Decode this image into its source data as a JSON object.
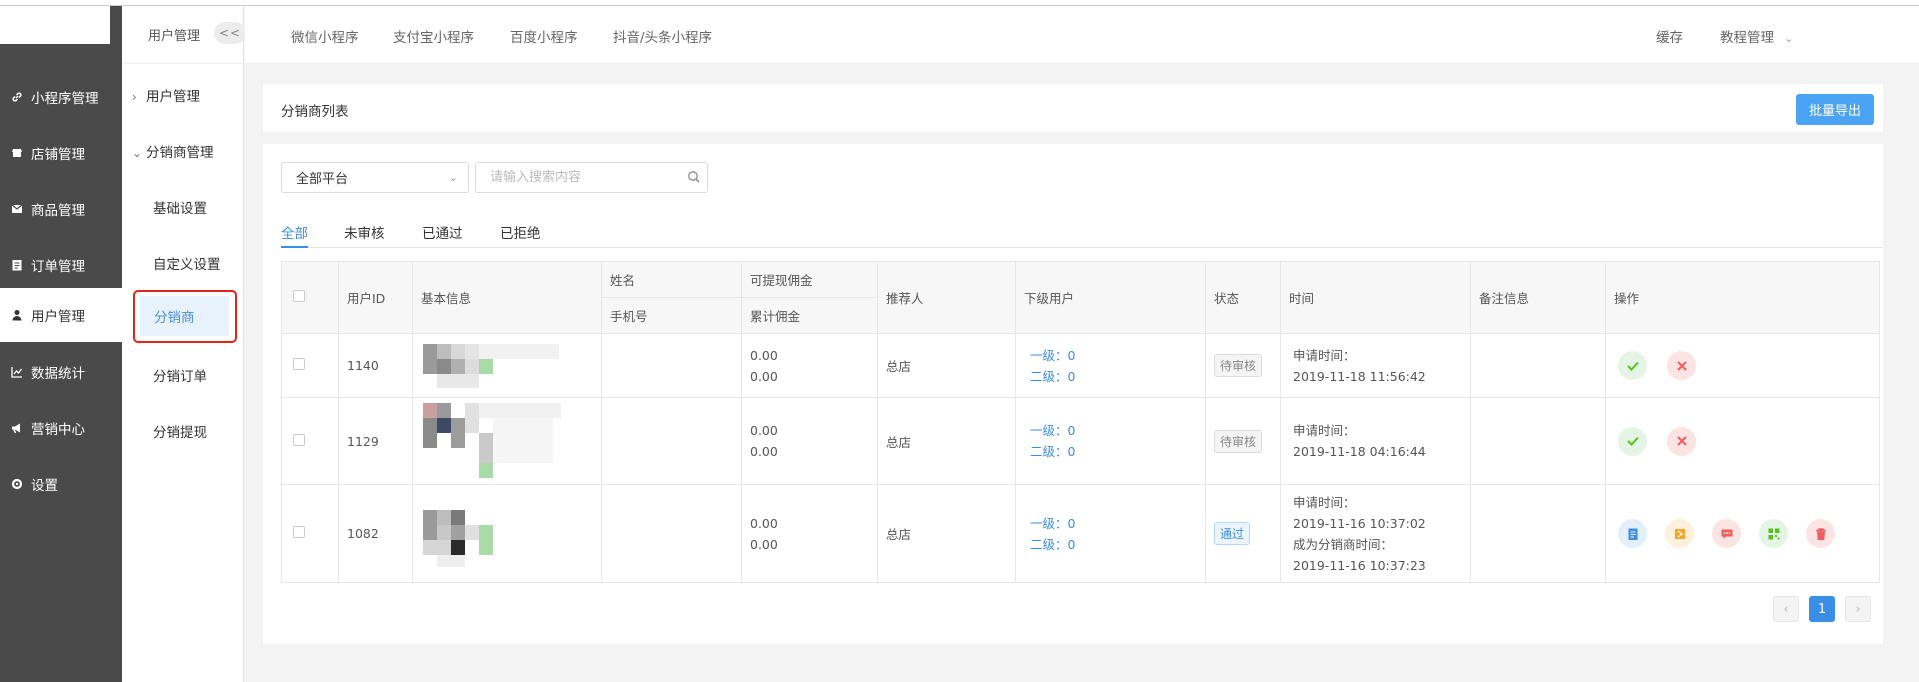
{
  "sidebar": {
    "items": [
      {
        "label": "小程序管理",
        "icon": "link-icon"
      },
      {
        "label": "店铺管理",
        "icon": "store-icon"
      },
      {
        "label": "商品管理",
        "icon": "mail-icon"
      },
      {
        "label": "订单管理",
        "icon": "clipboard-icon"
      },
      {
        "label": "用户管理",
        "icon": "user-icon"
      },
      {
        "label": "数据统计",
        "icon": "chart-icon"
      },
      {
        "label": "营销中心",
        "icon": "megaphone-icon"
      },
      {
        "label": "设置",
        "icon": "gear-icon"
      }
    ]
  },
  "subnav": {
    "title": "用户管理",
    "collapse": "<<",
    "group1": "用户管理",
    "group2": "分销商管理",
    "items": [
      "基础设置",
      "自定义设置",
      "分销商",
      "分销订单",
      "分销提现"
    ]
  },
  "header": {
    "tabs": [
      "微信小程序",
      "支付宝小程序",
      "百度小程序",
      "抖音/头条小程序"
    ],
    "cache": "缓存",
    "account": "教程管理"
  },
  "page": {
    "title": "分销商列表",
    "export_button": "批量导出"
  },
  "filters": {
    "platform": "全部平台",
    "search_placeholder": "请输入搜索内容"
  },
  "tabs": [
    "全部",
    "未审核",
    "已通过",
    "已拒绝"
  ],
  "table": {
    "headers": {
      "user_id": "用户ID",
      "basic": "基本信息",
      "name": "姓名",
      "phone": "手机号",
      "withdrawable": "可提现佣金",
      "total": "累计佣金",
      "referrer": "推荐人",
      "downline": "下级用户",
      "status": "状态",
      "time": "时间",
      "remark": "备注信息",
      "actions": "操作"
    },
    "rows": [
      {
        "id": "1140",
        "withdrawable": "0.00",
        "total": "0.00",
        "referrer": "总店",
        "level1": "一级：0",
        "level2": "二级：0",
        "status": "待审核",
        "time_label": "申请时间：",
        "time": "2019-11-18 11:56:42"
      },
      {
        "id": "1129",
        "withdrawable": "0.00",
        "total": "0.00",
        "referrer": "总店",
        "level1": "一级：0",
        "level2": "二级：0",
        "status": "待审核",
        "time_label": "申请时间：",
        "time": "2019-11-18 04:16:44"
      },
      {
        "id": "1082",
        "withdrawable": "0.00",
        "total": "0.00",
        "referrer": "总店",
        "level1": "一级：0",
        "level2": "二级：0",
        "status": "通过",
        "time_label": "申请时间：",
        "time": "2019-11-16 10:37:02",
        "time_label2": "成为分销商时间：",
        "time2": "2019-11-16 10:37:23"
      }
    ]
  },
  "pagination": {
    "prev": "‹",
    "current": "1",
    "next": "›"
  },
  "colors": {
    "accent": "#3a8ee6",
    "sidebar": "#4a4a4a",
    "highlight_border": "#e2231a"
  }
}
